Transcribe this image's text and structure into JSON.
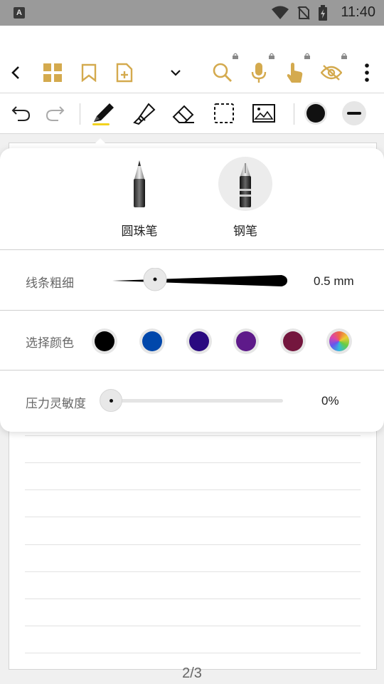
{
  "status_bar": {
    "app_badge": "A",
    "time": "11:40",
    "icons": [
      "wifi-icon",
      "no-sim-icon",
      "battery-charging-icon"
    ]
  },
  "toolbar_top": {
    "accent_color": "#D4AA4E",
    "items": [
      "back-icon",
      "thumbnails-icon",
      "bookmark-icon",
      "add-page-icon",
      "dropdown-chevron-icon",
      "search-icon",
      "microphone-icon",
      "touch-icon",
      "eye-off-icon",
      "more-icon"
    ],
    "locked_items": [
      "search-icon",
      "microphone-icon",
      "touch-icon",
      "eye-off-icon"
    ]
  },
  "toolbar_tools": {
    "items": [
      "undo-icon",
      "redo-icon",
      "pen-icon",
      "highlighter-icon",
      "eraser-icon",
      "lasso-select-icon",
      "image-icon",
      "color-icon",
      "stroke-width-icon"
    ],
    "selected": "pen-icon",
    "current_color": "#111111"
  },
  "pen_popup": {
    "pen_types": [
      {
        "label": "圆珠笔",
        "icon": "ballpoint-pen-icon",
        "active": false
      },
      {
        "label": "钢笔",
        "icon": "fountain-pen-icon",
        "active": true
      }
    ],
    "stroke_width": {
      "label": "线条粗细",
      "value": "0.5 mm"
    },
    "color": {
      "label": "选择颜色",
      "swatches": [
        "#000000",
        "#0047AB",
        "#2A0A80",
        "#5E1A8A",
        "#74163E",
        "palette"
      ]
    },
    "pressure": {
      "label": "压力灵敏度",
      "value": "0%",
      "level": 0
    }
  },
  "page": {
    "indicator": "2/3"
  }
}
